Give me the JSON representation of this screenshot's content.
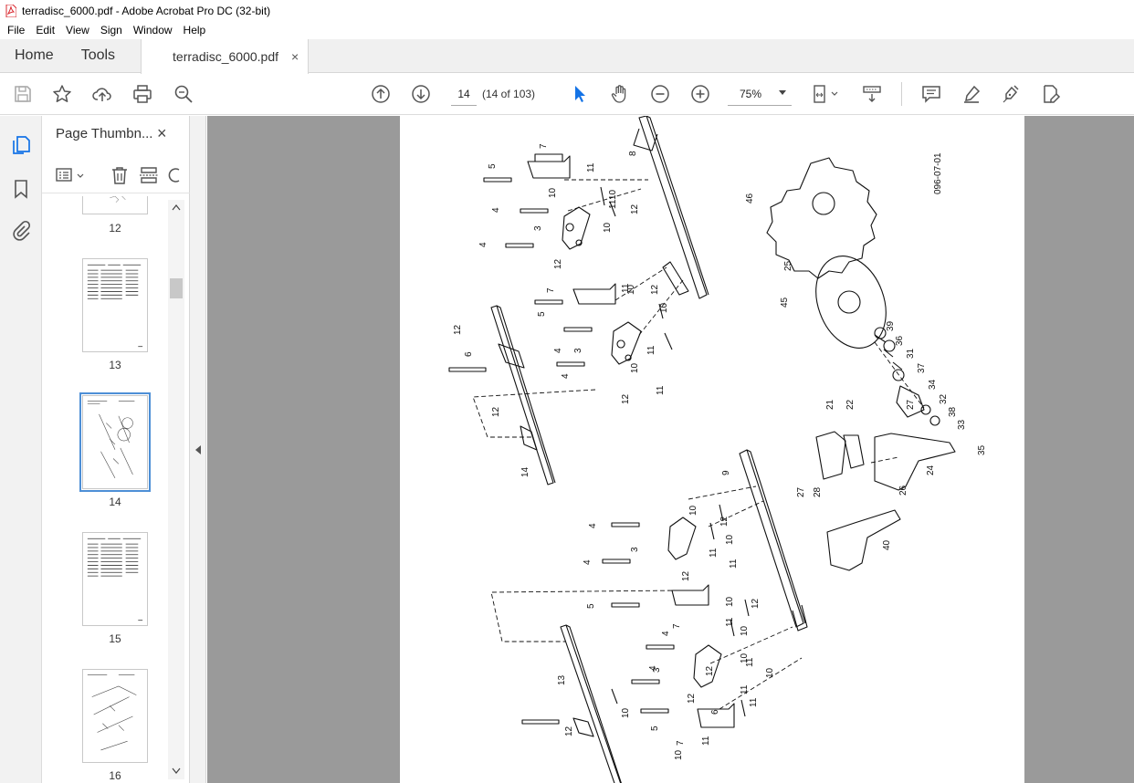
{
  "window": {
    "title": "terradisc_6000.pdf - Adobe Acrobat Pro DC (32-bit)"
  },
  "menu": [
    "File",
    "Edit",
    "View",
    "Sign",
    "Window",
    "Help"
  ],
  "tabs": {
    "home": "Home",
    "tools": "Tools",
    "document": "terradisc_6000.pdf",
    "close": "×"
  },
  "toolbar": {
    "current_page": "14",
    "page_count": "(14 of 103)",
    "zoom": "75%"
  },
  "panel": {
    "title": "Page Thumbn...",
    "close": "×",
    "thumbnails": [
      {
        "label": "12"
      },
      {
        "label": "13"
      },
      {
        "label": "14",
        "selected": true
      },
      {
        "label": "15"
      },
      {
        "label": "16"
      }
    ]
  },
  "drawing": {
    "code": "096-07-01",
    "part_labels": [
      "1",
      "3",
      "4",
      "5",
      "6",
      "7",
      "8",
      "9",
      "10",
      "11",
      "12",
      "13",
      "14",
      "21",
      "22",
      "24",
      "25",
      "26",
      "27",
      "28",
      "31",
      "32",
      "33",
      "34",
      "35",
      "36",
      "37",
      "38",
      "39",
      "40",
      "45",
      "46"
    ]
  },
  "colors": {
    "accent": "#1473e6",
    "pdf_red": "#d9282f",
    "doc_bg": "#9a9a9a"
  }
}
